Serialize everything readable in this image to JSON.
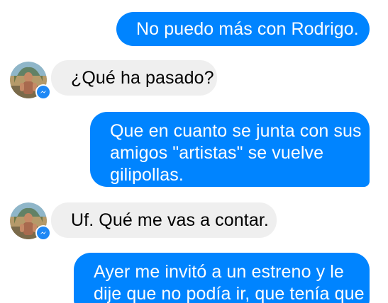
{
  "colors": {
    "outgoing_bubble": "#0084ff",
    "incoming_bubble": "#efefef",
    "background": "#ffffff"
  },
  "messages": [
    {
      "direction": "outgoing",
      "lines": [
        "No puedo más con Rodrigo."
      ]
    },
    {
      "direction": "incoming",
      "lines": [
        "¿Qué ha pasado?"
      ],
      "avatar_icon": "messenger-icon"
    },
    {
      "direction": "outgoing",
      "lines": [
        "Que en cuanto se junta con sus",
        "amigos \"artistas\" se vuelve",
        "gilipollas."
      ]
    },
    {
      "direction": "incoming",
      "lines": [
        "Uf. Qué me vas a contar."
      ],
      "avatar_icon": "messenger-icon"
    },
    {
      "direction": "outgoing",
      "lines": [
        "Ayer me invitó a un estreno y le",
        "dije que no podía ir, que tenía que"
      ]
    }
  ]
}
